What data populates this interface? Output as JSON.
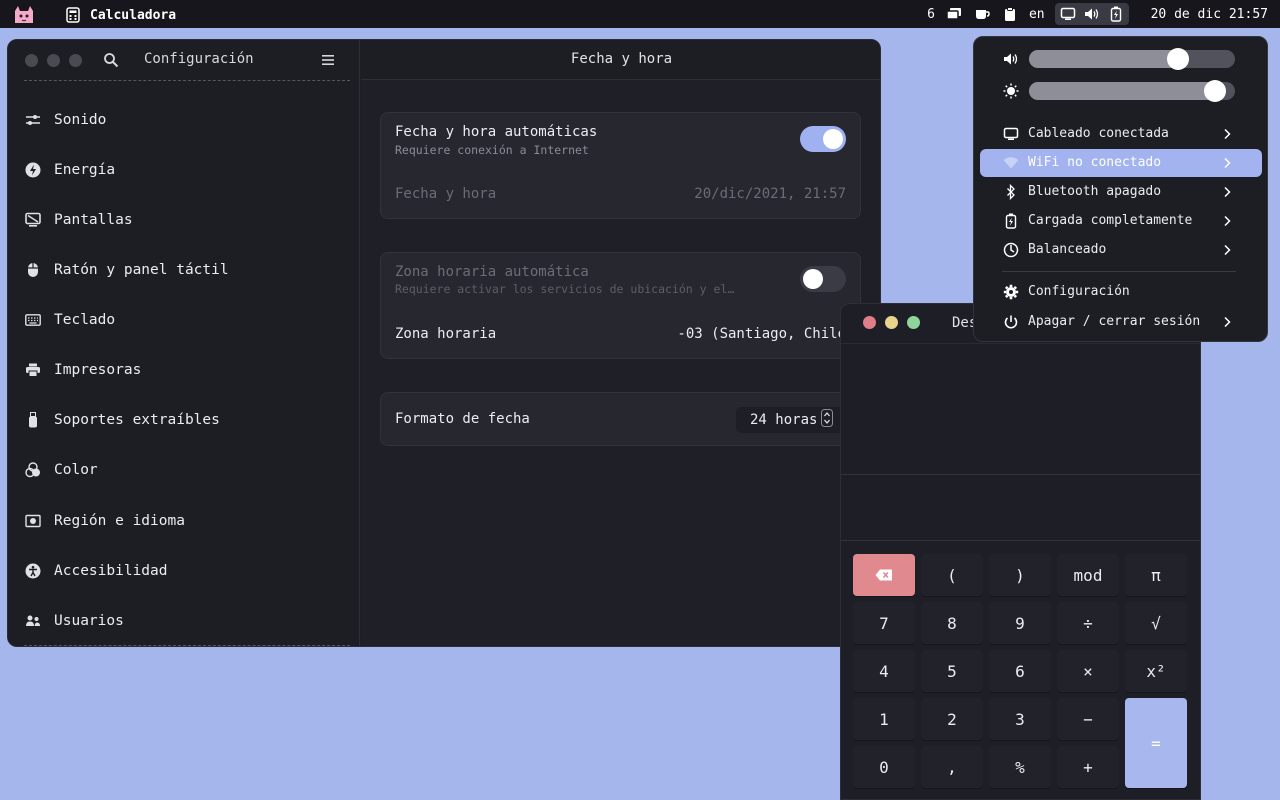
{
  "topbar": {
    "app_name": "Calculadora",
    "workspace": "6",
    "language": "en",
    "clock": "20 de dic 21:57"
  },
  "settings": {
    "title": "Configuración",
    "sidebar_items": [
      {
        "label": "Sonido",
        "icon": "sliders-icon"
      },
      {
        "label": "Energía",
        "icon": "lightning-icon"
      },
      {
        "label": "Pantallas",
        "icon": "display-icon"
      },
      {
        "label": "Ratón y panel táctil",
        "icon": "mouse-icon"
      },
      {
        "label": "Teclado",
        "icon": "keyboard-icon"
      },
      {
        "label": "Impresoras",
        "icon": "printer-icon"
      },
      {
        "label": "Soportes extraíbles",
        "icon": "usb-icon"
      },
      {
        "label": "Color",
        "icon": "color-circles-icon"
      },
      {
        "label": "Región e idioma",
        "icon": "flag-icon"
      },
      {
        "label": "Accesibilidad",
        "icon": "accessibility-icon"
      },
      {
        "label": "Usuarios",
        "icon": "users-icon"
      }
    ],
    "page_title": "Fecha y hora",
    "auto_datetime": {
      "title": "Fecha y hora automáticas",
      "subtitle": "Requiere conexión a Internet",
      "enabled": true
    },
    "datetime": {
      "label": "Fecha y hora",
      "value": "20/dic/2021, 21:57"
    },
    "auto_timezone": {
      "title": "Zona horaria automática",
      "subtitle": "Requiere activar los servicios de ubicación y el…",
      "enabled": false
    },
    "timezone": {
      "label": "Zona horaria",
      "value": "-03 (Santiago, Chile"
    },
    "date_format": {
      "label": "Formato de fecha",
      "value": "24 horas"
    }
  },
  "calculator": {
    "title_partial": "Des",
    "keys": [
      [
        "⌫",
        "(",
        ")",
        "mod",
        "π"
      ],
      [
        "7",
        "8",
        "9",
        "÷",
        "√"
      ],
      [
        "4",
        "5",
        "6",
        "×",
        "x²"
      ],
      [
        "1",
        "2",
        "3",
        "−",
        "="
      ],
      [
        "0",
        ",",
        "%",
        "+",
        ""
      ]
    ],
    "colors": {
      "delete": "#e08a8f",
      "equals": "#a8b7ee"
    }
  },
  "quick_settings": {
    "volume_level": 0.75,
    "brightness_level": 0.95,
    "items": [
      {
        "label": "Cableado conectada",
        "icon": "monitor-icon",
        "active": false
      },
      {
        "label": "WiFi no conectado",
        "icon": "wifi-icon",
        "active": true
      },
      {
        "label": "Bluetooth apagado",
        "icon": "bluetooth-icon",
        "active": false
      },
      {
        "label": "Cargada completamente",
        "icon": "battery-icon",
        "active": false
      },
      {
        "label": "Balanceado",
        "icon": "power-profile-icon",
        "active": false
      }
    ],
    "settings_label": "Configuración",
    "power_label": "Apagar / cerrar sesión"
  },
  "colors": {
    "desktop": "#a5b6ed",
    "accent": "#9fb1f0",
    "window_bg": "#1d1d24"
  }
}
